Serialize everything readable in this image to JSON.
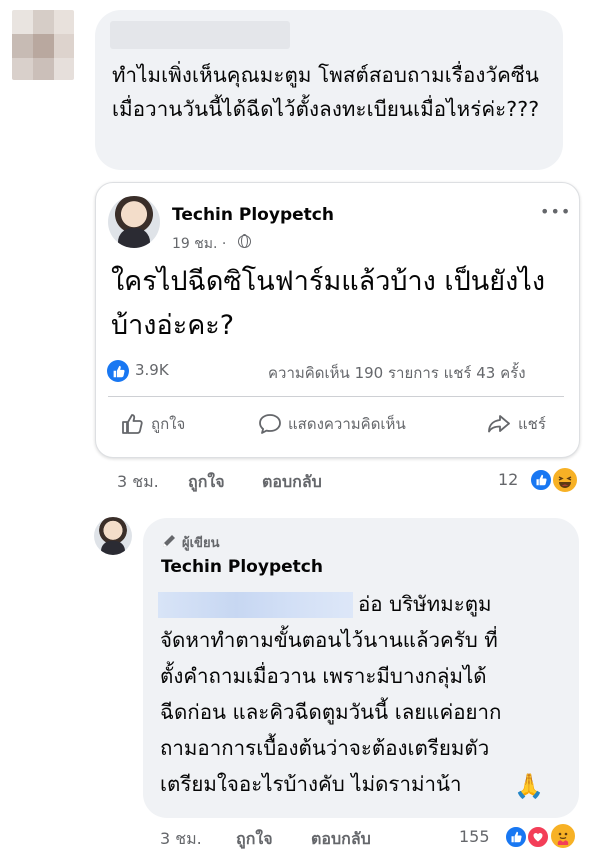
{
  "comment1": {
    "text": "ทำไมเพิ่งเห็นคุณมะตูม โพสต์สอบถามเรื่องวัคซีนเมื่อวานวันนี้ได้ฉีดไว้ตั้งลงทะเบียนเมื่อไหร่ค่ะ???",
    "time": "3 ชม.",
    "like_label": "ถูกใจ",
    "reply_label": "ตอบกลับ",
    "reaction_count": "12",
    "reactions": [
      "like-icon",
      "haha-icon"
    ]
  },
  "shared_post": {
    "author": "Techin Ploypetch",
    "time": "19 ชม. ·",
    "privacy_icon": "globe-icon",
    "text": "ใครไปฉีดซิโนฟาร์มแล้วบ้าง เป็นยังไงบ้างอ่ะคะ?",
    "like_count": "3.9K",
    "stats": "ความคิดเห็น 190 รายการ  แชร์ 43 ครั้ง",
    "actions": {
      "like": "ถูกใจ",
      "comment": "แสดงความคิดเห็น",
      "share": "แชร์"
    }
  },
  "reply": {
    "badge": "ผู้เขียน",
    "author": "Techin Ploypetch",
    "lines": [
      "อ่อ บริษัทมะตูม",
      "จัดหาทำตามขั้นตอนไว้นานแล้วครับ ที่",
      "ตั้งคำถามเมื่อวาน เพราะมีบางกลุ่มได้",
      "ฉีดก่อน และคิวฉีดตูมวันนี้ เลยแค่อยาก",
      "ถามอาการเบื้องต้นว่าจะต้องเตรียมตัว",
      "เตรียมใจอะไรบ้างคับ ไม่ดราม่าน้า"
    ],
    "time": "3 ชม.",
    "like_label": "ถูกใจ",
    "reply_label": "ตอบกลับ",
    "reaction_count": "155",
    "reactions": [
      "like-icon",
      "love-icon",
      "care-icon"
    ]
  },
  "colors": {
    "bubble": "#f0f2f5",
    "muted_text": "#65676b",
    "like_blue": "#1877f2",
    "love_red": "#f33e58",
    "emoji_yellow": "#f7b125"
  }
}
